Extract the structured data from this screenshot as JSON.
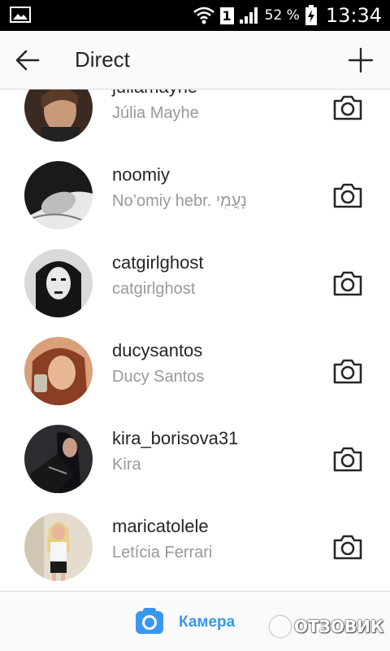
{
  "status_bar": {
    "battery_percent": "52 %",
    "sim_label": "1",
    "time": "13:34"
  },
  "header": {
    "title": "Direct",
    "back_icon": "arrow-left-icon",
    "new_icon": "plus-icon"
  },
  "contacts": [
    {
      "username": "juliamayhe",
      "full_name": "Júlia Mayhe",
      "avatar_color": "#7a5a48"
    },
    {
      "username": "noomiy",
      "full_name": "No’omiy hebr. נָעֳמִי",
      "avatar_color": "#3a3a3a"
    },
    {
      "username": "catgirlghost",
      "full_name": "catgirlghost",
      "avatar_color": "#2a2a2a"
    },
    {
      "username": "ducysantos",
      "full_name": "Ducy Santos",
      "avatar_color": "#c07a55"
    },
    {
      "username": "kira_borisova31",
      "full_name": "Kira",
      "avatar_color": "#1e1e22"
    },
    {
      "username": "maricatolele",
      "full_name": "Letícia Ferrari",
      "avatar_color": "#d8cdb8"
    }
  ],
  "bottom_bar": {
    "camera_label": "Камера",
    "accent_color": "#3897f0"
  },
  "watermark": {
    "text": "ОТЗОВИК"
  }
}
